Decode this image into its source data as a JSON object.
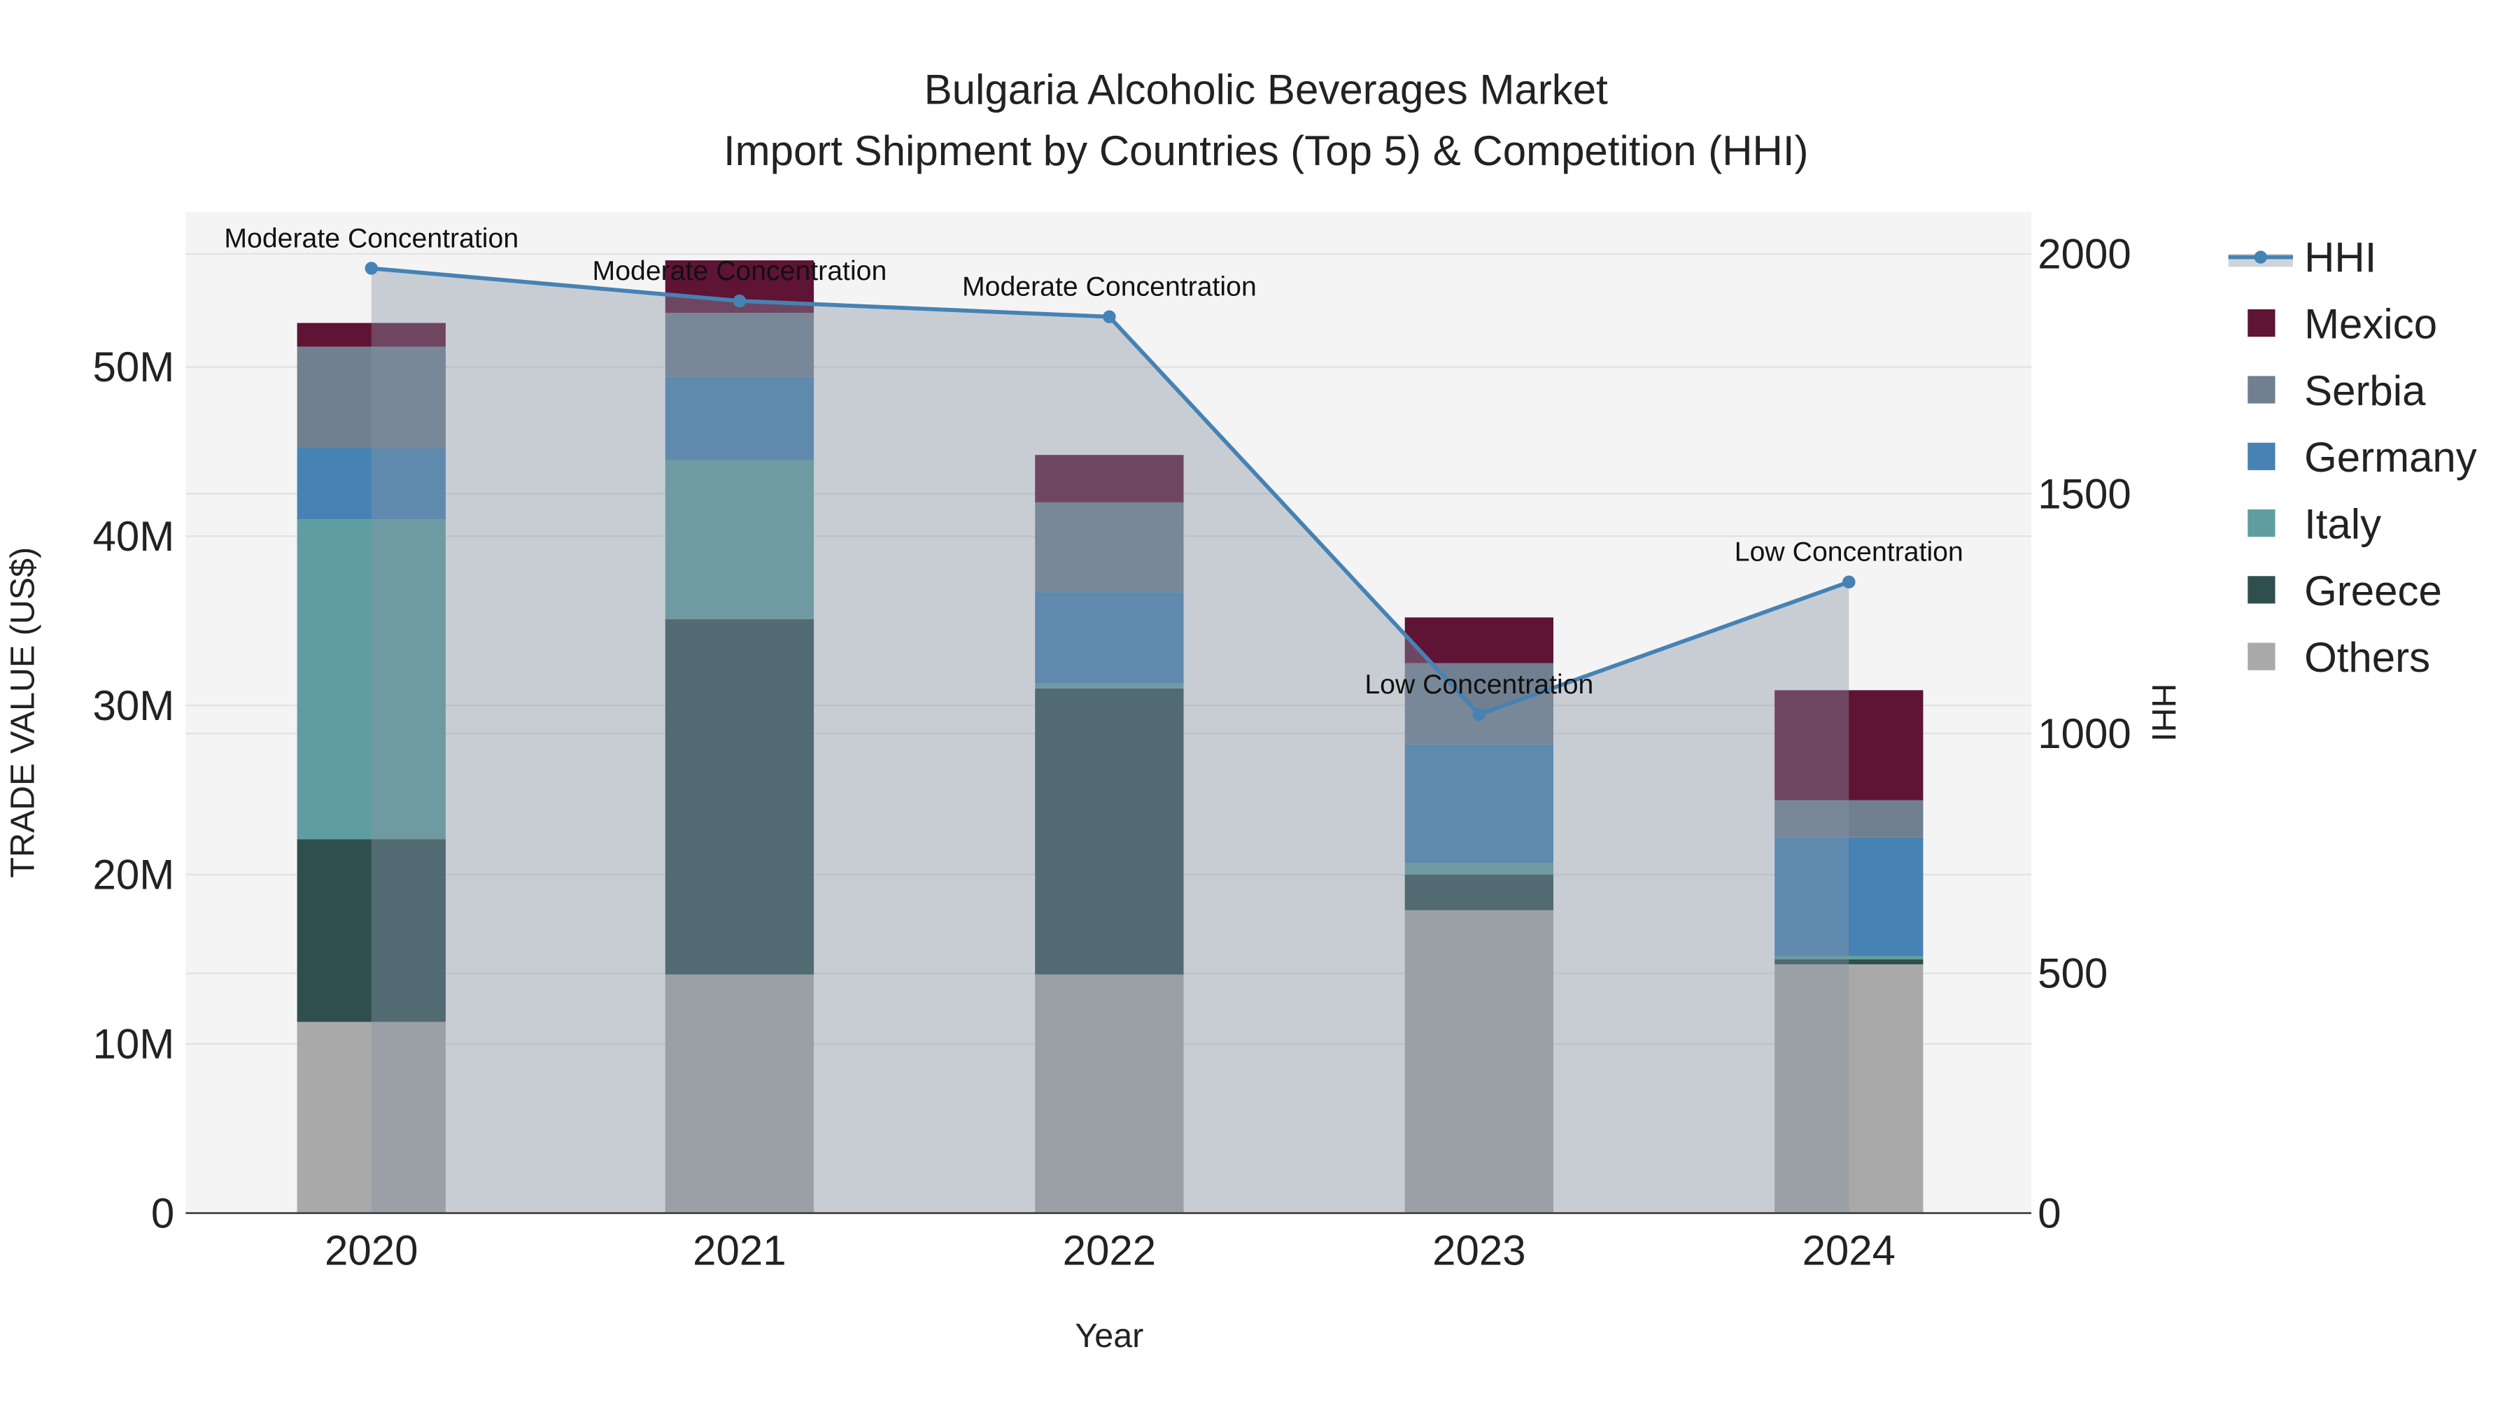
{
  "chart_data": {
    "type": "bar",
    "stacked": true,
    "title": "Bulgaria Alcoholic Beverages Market",
    "subtitle": "Import Shipment by Countries (Top 5) & Competition (HHI)",
    "xlabel": "Year",
    "ylabel": "TRADE VALUE (US$)",
    "y2label": "HHI",
    "categories": [
      "2020",
      "2021",
      "2022",
      "2023",
      "2024"
    ],
    "ylim": [
      0,
      59
    ],
    "y_ticks": [
      0,
      10,
      20,
      30,
      40,
      50
    ],
    "y_tick_labels": [
      "0",
      "10M",
      "20M",
      "30M",
      "40M",
      "50M"
    ],
    "y2lim": [
      0,
      2090
    ],
    "y2_ticks": [
      0,
      500,
      1000,
      1500,
      2000
    ],
    "y2_tick_labels": [
      "0",
      "500",
      "1000",
      "1500",
      "2000"
    ],
    "units": "US$ millions",
    "series": [
      {
        "name": "Others",
        "color": "#a9a9a9",
        "values": [
          11.3,
          14.1,
          14.1,
          17.9,
          14.7
        ]
      },
      {
        "name": "Greece",
        "color": "#2f4f4f",
        "values": [
          10.8,
          21.0,
          16.9,
          2.1,
          0.3
        ]
      },
      {
        "name": "Italy",
        "color": "#5f9ea0",
        "values": [
          18.9,
          9.4,
          0.3,
          0.7,
          0.2
        ]
      },
      {
        "name": "Germany",
        "color": "#4682b4",
        "values": [
          4.2,
          4.9,
          5.4,
          7.0,
          7.0
        ]
      },
      {
        "name": "Serbia",
        "color": "#708090",
        "values": [
          6.0,
          3.8,
          5.3,
          4.8,
          2.2
        ]
      },
      {
        "name": "Mexico",
        "color": "#5f1335",
        "values": [
          1.4,
          3.1,
          2.8,
          2.7,
          6.5
        ]
      }
    ],
    "hhi": {
      "name": "HHI",
      "color": "#4682b4",
      "values": [
        1970,
        1902,
        1869,
        1040,
        1316
      ],
      "annotations": [
        "Moderate Concentration",
        "Moderate Concentration",
        "Moderate Concentration",
        "Low Concentration",
        "Low Concentration"
      ]
    },
    "legend_order": [
      "HHI",
      "Mexico",
      "Serbia",
      "Germany",
      "Italy",
      "Greece",
      "Others"
    ],
    "legend_position": "right",
    "grid": true
  }
}
